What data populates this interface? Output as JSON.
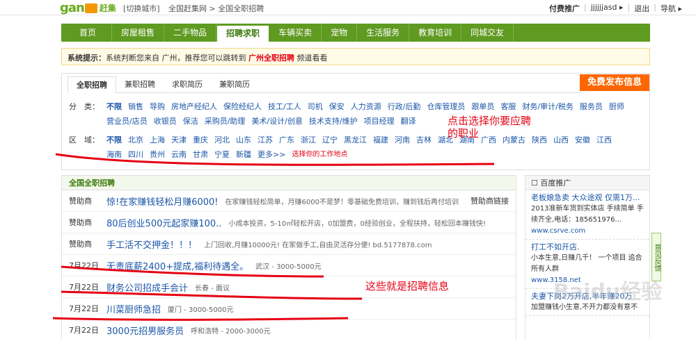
{
  "topbar": {
    "logo_text": "gan",
    "logo_text2": "赶集",
    "city_switch": "[切换城市]",
    "breadcrumb": "全国赶集网 > 全国全职招聘",
    "paid_promo": "付费推广",
    "sep": "|",
    "user": "jjjjjjasd",
    "user_arrow": "▸",
    "logout": "退出",
    "nav": "导航",
    "nav_arrow": "▸"
  },
  "nav": {
    "items": [
      "首页",
      "房屋租售",
      "二手物品",
      "招聘求职",
      "车辆买卖",
      "宠物",
      "生活服务",
      "教育培训",
      "同城交友"
    ],
    "active_index": 3
  },
  "notice": {
    "label": "系统提示：",
    "text1": "系统判断您来自 广州，推荐您可以跳转到",
    "link": "广州全职招聘",
    "text2": "频道看看"
  },
  "filter": {
    "tabs": [
      "全职招聘",
      "兼职招聘",
      "求职简历",
      "兼职简历"
    ],
    "post_button": "免费发布信息",
    "category_label": "分　类：",
    "categories": [
      "不限",
      "销售",
      "导购",
      "房地产经纪人",
      "保险经纪人",
      "技工/工人",
      "司机",
      "保安",
      "人力资源",
      "行政/后勤",
      "仓库管理员",
      "跟单员",
      "客服",
      "财务/审计/税务",
      "服务员",
      "厨师",
      "营业员/店员",
      "收银员",
      "保洁",
      "采购员/助理",
      "美术/设计/创意",
      "技术支持/维护",
      "项目经理",
      "翻译"
    ],
    "area_label": "区　域：",
    "areas": [
      "不限",
      "北京",
      "上海",
      "天津",
      "重庆",
      "河北",
      "山东",
      "江苏",
      "广东",
      "浙江",
      "辽宁",
      "黑龙江",
      "福建",
      "河南",
      "吉林",
      "湖北",
      "湖南",
      "广西",
      "内蒙古",
      "陕西",
      "山西",
      "安徽",
      "江西",
      "海南",
      "四川",
      "贵州",
      "云南",
      "甘肃",
      "宁夏",
      "新疆"
    ],
    "more": "更多>>",
    "area_tip": "选择你的工作地点"
  },
  "annotations": {
    "a1": "点击选择你要应聘的职业",
    "a2": "这些就是招聘信息"
  },
  "main": {
    "header": "全国全职招聘",
    "rows": [
      {
        "date": "赞助商",
        "title": "惊!在家赚钱轻松月赚6000!",
        "desc": "在家赚钱轻松简单，月赚6000不是梦！零基础免费培训，赚到钱后再付培训",
        "link": "赞助商链接"
      },
      {
        "date": "赞助商",
        "title": "80后创业500元起家赚100..",
        "desc": "小成本投资，5-10㎡轻松开店，0加盟费，0经验创业，全程扶持，轻松回本赚钱快!",
        "link": ""
      },
      {
        "date": "赞助商",
        "title": "手工活不交押金！！！",
        "desc": "上门回收,月赚10000元! 在家做手工,自由灵活存分便! bd.5177878.com",
        "link": ""
      },
      {
        "date": "7月22日",
        "title": "无责底薪2400+提成,福利待遇全。",
        "desc": "武汉 - 3000-5000元",
        "link": ""
      },
      {
        "date": "7月22日",
        "title": "财务公司招成手会计",
        "desc": "长春 - 面议",
        "link": ""
      },
      {
        "date": "7月22日",
        "title": "川菜厨师急招",
        "desc": "厦门 - 3000-5000元",
        "link": ""
      },
      {
        "date": "7月22日",
        "title": "3000元招男服务员",
        "desc": "呼和浩特 - 2000-3000元",
        "link": ""
      }
    ]
  },
  "sidebar": {
    "header": "百度推广",
    "ads": [
      {
        "title": "老板娘急卖 大众途观 仅需1万...",
        "body": "2013准新车货到实体店 手续简单 手续齐全,电话：185651976...",
        "url": "www.csrve.com"
      },
      {
        "title": "打工不如开店.",
        "body": "小本生意,日赚几千！ 一个项目 追合所有人群",
        "url": "www.3158.net"
      },
      {
        "title": "夫妻下岗2万开店,半年赚20万",
        "body": "加盟赚钱小生意,不开力都没有意不",
        "url": ""
      }
    ]
  },
  "feedback": "意见反馈",
  "watermark": "Baidu经验"
}
